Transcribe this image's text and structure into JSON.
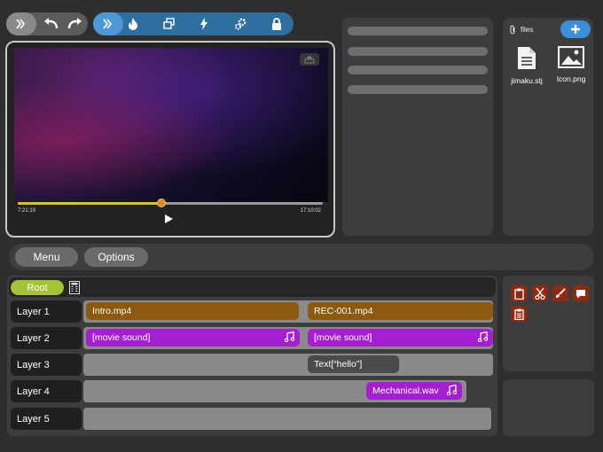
{
  "toolbar_left": {
    "items": [
      "forward-icon",
      "undo-icon",
      "redo-icon"
    ]
  },
  "toolbar_right": {
    "items": [
      "forward-icon",
      "flame-icon",
      "layers-icon",
      "bolt-icon",
      "gears-icon",
      "lock-icon"
    ]
  },
  "player": {
    "time_start": "7:21:19",
    "time_end": "17:10:02",
    "progress": 0.47
  },
  "files": {
    "label": "files",
    "items": [
      {
        "name": "jimaku.stj",
        "icon": "document-icon"
      },
      {
        "name": "Icon.png",
        "icon": "image-icon"
      }
    ]
  },
  "menu": {
    "menu_label": "Menu",
    "options_label": "Options"
  },
  "timeline": {
    "root_label": "Root",
    "layers": [
      {
        "label": "Layer 1",
        "clips": [
          {
            "text": "Intro.mp4",
            "kind": "video"
          },
          {
            "text": "REC-001.mp4",
            "kind": "video"
          }
        ]
      },
      {
        "label": "Layer 2",
        "clips": [
          {
            "text": "[movie sound]",
            "kind": "audio"
          },
          {
            "text": "[movie sound]",
            "kind": "audio"
          }
        ]
      },
      {
        "label": "Layer 3",
        "clips": [
          {
            "text": "Text[“hello”]",
            "kind": "text"
          }
        ]
      },
      {
        "label": "Layer 4",
        "clips": [
          {
            "text": "Mechanical.wav",
            "kind": "audio"
          }
        ]
      },
      {
        "label": "Layer 5",
        "clips": []
      }
    ]
  },
  "tools": [
    "clipboard-icon",
    "scissors-icon",
    "brush-icon",
    "comment-icon",
    "paste-icon"
  ],
  "colors": {
    "accent_blue": "#3a8fd8",
    "root_green": "#a6c236",
    "video_clip": "#8b5a10",
    "audio_clip": "#a41fcf",
    "tool_red": "#8f2a10"
  }
}
